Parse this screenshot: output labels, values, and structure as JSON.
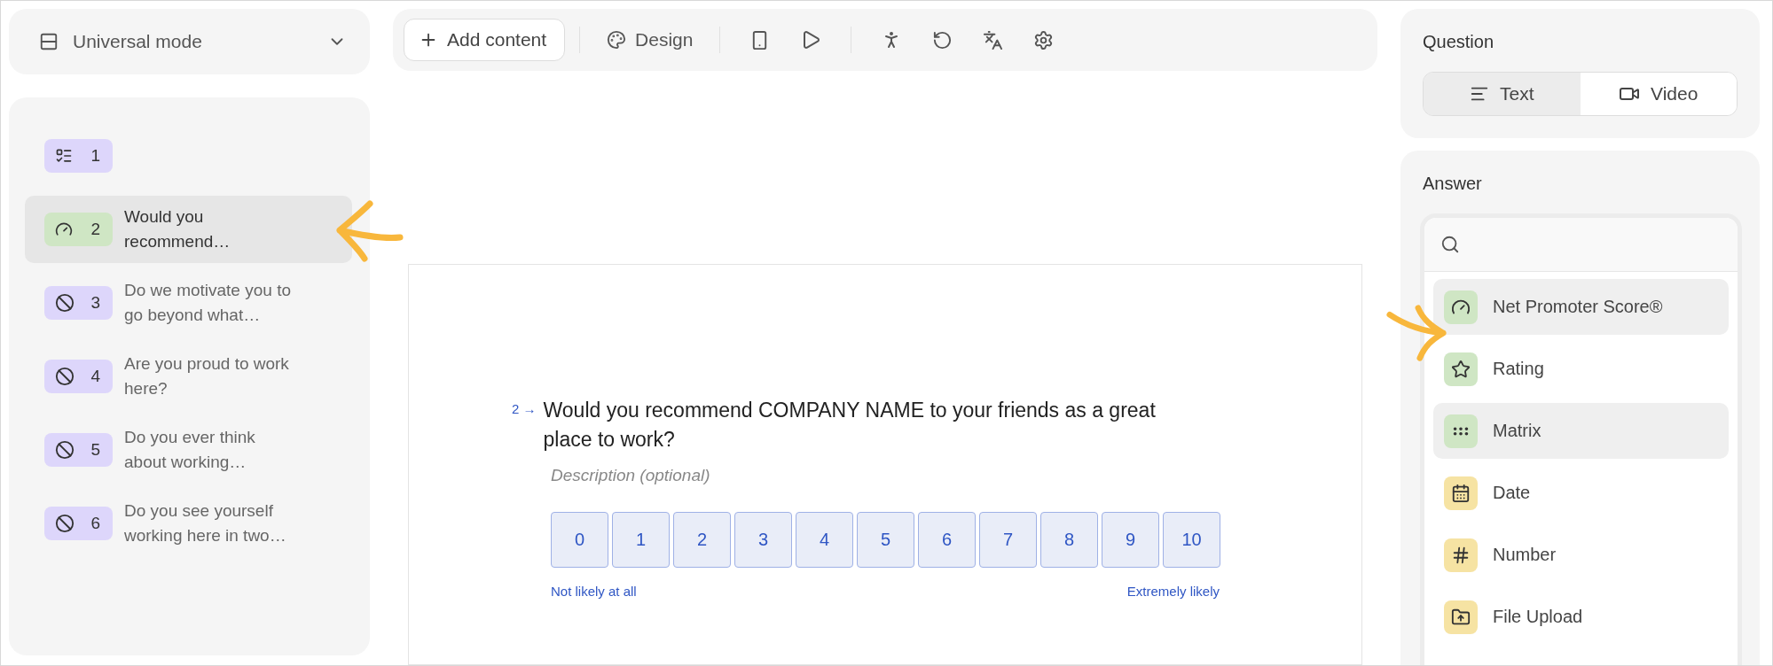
{
  "mode_select": {
    "label": "Universal mode"
  },
  "toolbar": {
    "add_button": "Add content",
    "design_button": "Design"
  },
  "questions": [
    {
      "number": "1",
      "kind": "choice",
      "color": "#ddd6fb",
      "selected": false
    },
    {
      "number": "2",
      "text": "Would you recommend…",
      "kind": "nps",
      "color": "#cfe6c4",
      "selected": true
    },
    {
      "number": "3",
      "text": "Do we motivate you to go beyond what…",
      "kind": "hidden",
      "color": "#ddd6fb",
      "selected": false
    },
    {
      "number": "4",
      "text": "Are you proud to work here?",
      "kind": "hidden",
      "color": "#ddd6fb",
      "selected": false
    },
    {
      "number": "5",
      "text": "Do you ever think about working…",
      "kind": "hidden",
      "color": "#ddd6fb",
      "selected": false
    },
    {
      "number": "6",
      "text": "Do you see yourself working here in two…",
      "kind": "hidden",
      "color": "#ddd6fb",
      "selected": false
    }
  ],
  "canvas": {
    "number": "2",
    "arrow": "→",
    "title": "Would you recommend COMPANY NAME to your friends as a great place to work?",
    "description_placeholder": "Description (optional)",
    "scale": [
      "0",
      "1",
      "2",
      "3",
      "4",
      "5",
      "6",
      "7",
      "8",
      "9",
      "10"
    ],
    "low_label": "Not likely at all",
    "high_label": "Extremely likely"
  },
  "question_panel": {
    "title": "Question",
    "tabs": [
      {
        "label": "Text",
        "kind": "text",
        "selected": true
      },
      {
        "label": "Video",
        "kind": "video",
        "selected": false
      }
    ]
  },
  "answer_panel": {
    "title": "Answer",
    "types": [
      {
        "label": "Net Promoter Score®",
        "kind": "nps",
        "color": "#cfe6c4",
        "highlighted": true
      },
      {
        "label": "Rating",
        "kind": "rating",
        "color": "#cfe6c4",
        "highlighted": false
      },
      {
        "label": "Matrix",
        "kind": "matrix",
        "color": "#cfe6c4",
        "highlighted": true
      },
      {
        "label": "Date",
        "kind": "date",
        "color": "#f6e3a3",
        "highlighted": false
      },
      {
        "label": "Number",
        "kind": "number",
        "color": "#f6e3a3",
        "highlighted": false
      },
      {
        "label": "File Upload",
        "kind": "upload",
        "color": "#f6e3a3",
        "highlighted": false
      }
    ]
  }
}
